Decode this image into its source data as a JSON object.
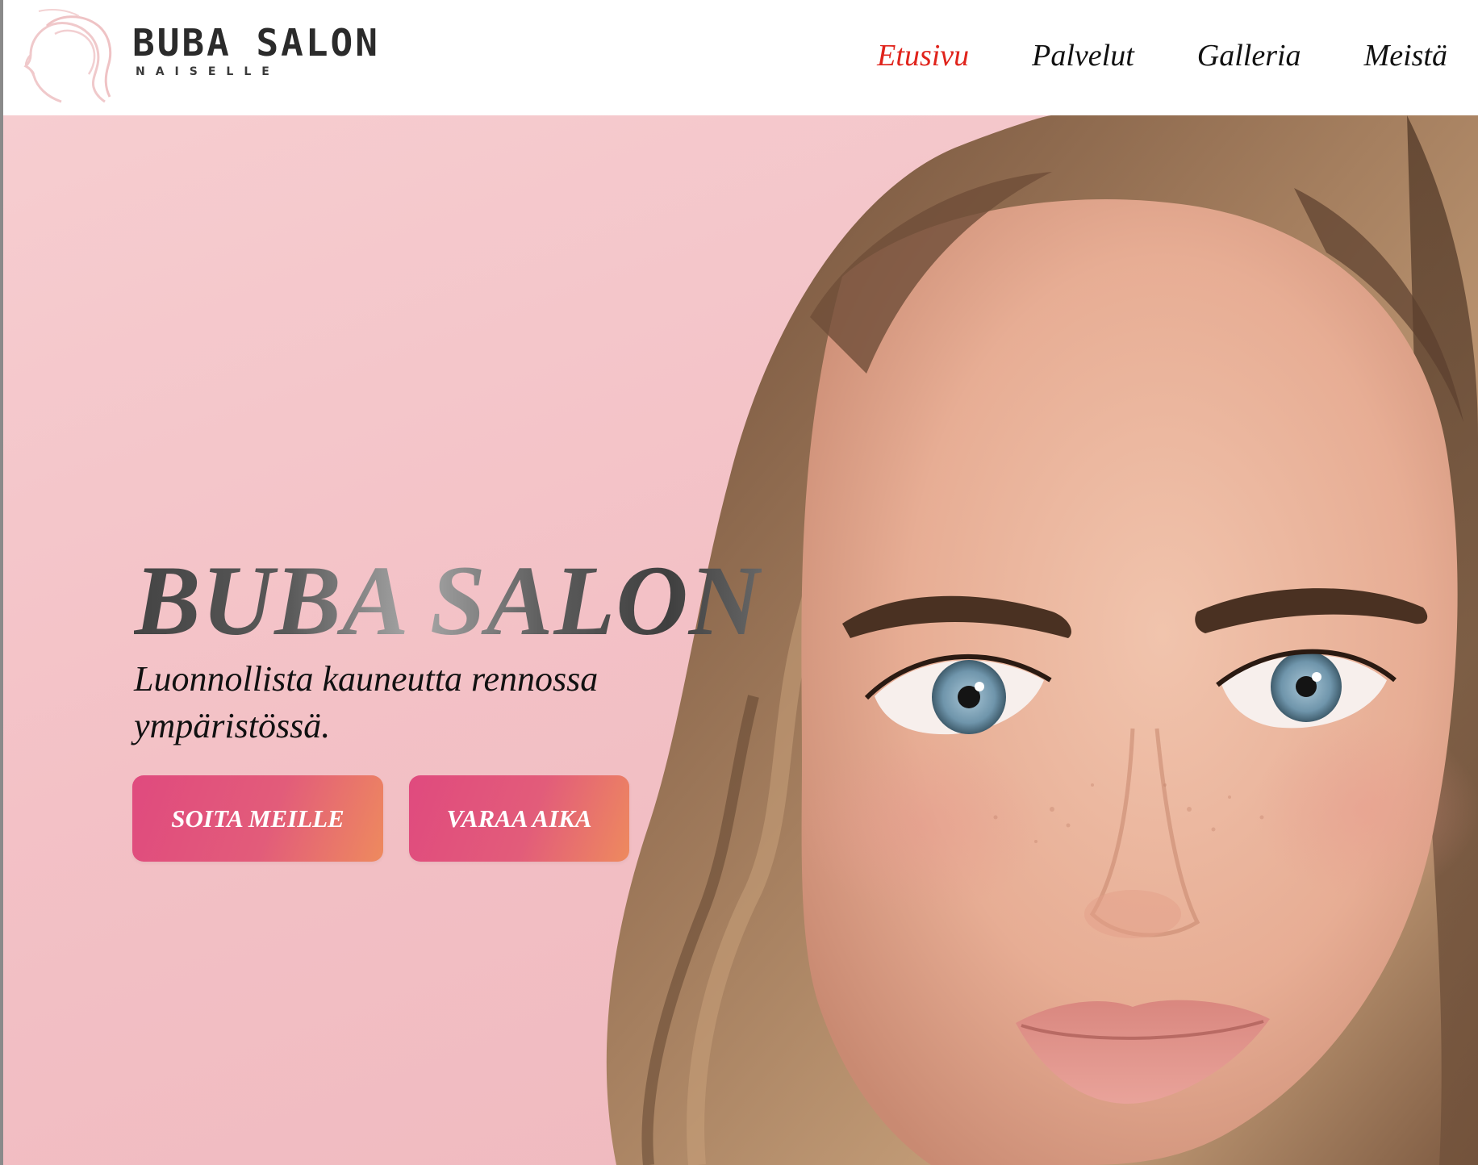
{
  "logo": {
    "title": "BUBA SALON",
    "subtitle": "NAISELLE",
    "mark_icon": "woman-profile-icon"
  },
  "nav": {
    "items": [
      {
        "label": "Etusivu",
        "active": true
      },
      {
        "label": "Palvelut",
        "active": false
      },
      {
        "label": "Galleria",
        "active": false
      },
      {
        "label": "Meistä",
        "active": false
      }
    ]
  },
  "hero": {
    "title": "BUBA SALON",
    "subtitle": "Luonnollista kauneutta rennossa ympäristössä.",
    "buttons": {
      "call": "SOITA MEILLE",
      "book": "VARAA AIKA"
    },
    "image": "woman-portrait"
  },
  "colors": {
    "active_nav": "#e0241c",
    "hero_background": "#f3c1c6",
    "button_gradient_start": "#e04a7e",
    "button_gradient_end": "#ee8a5e",
    "logo_accent": "#eec2c4"
  }
}
